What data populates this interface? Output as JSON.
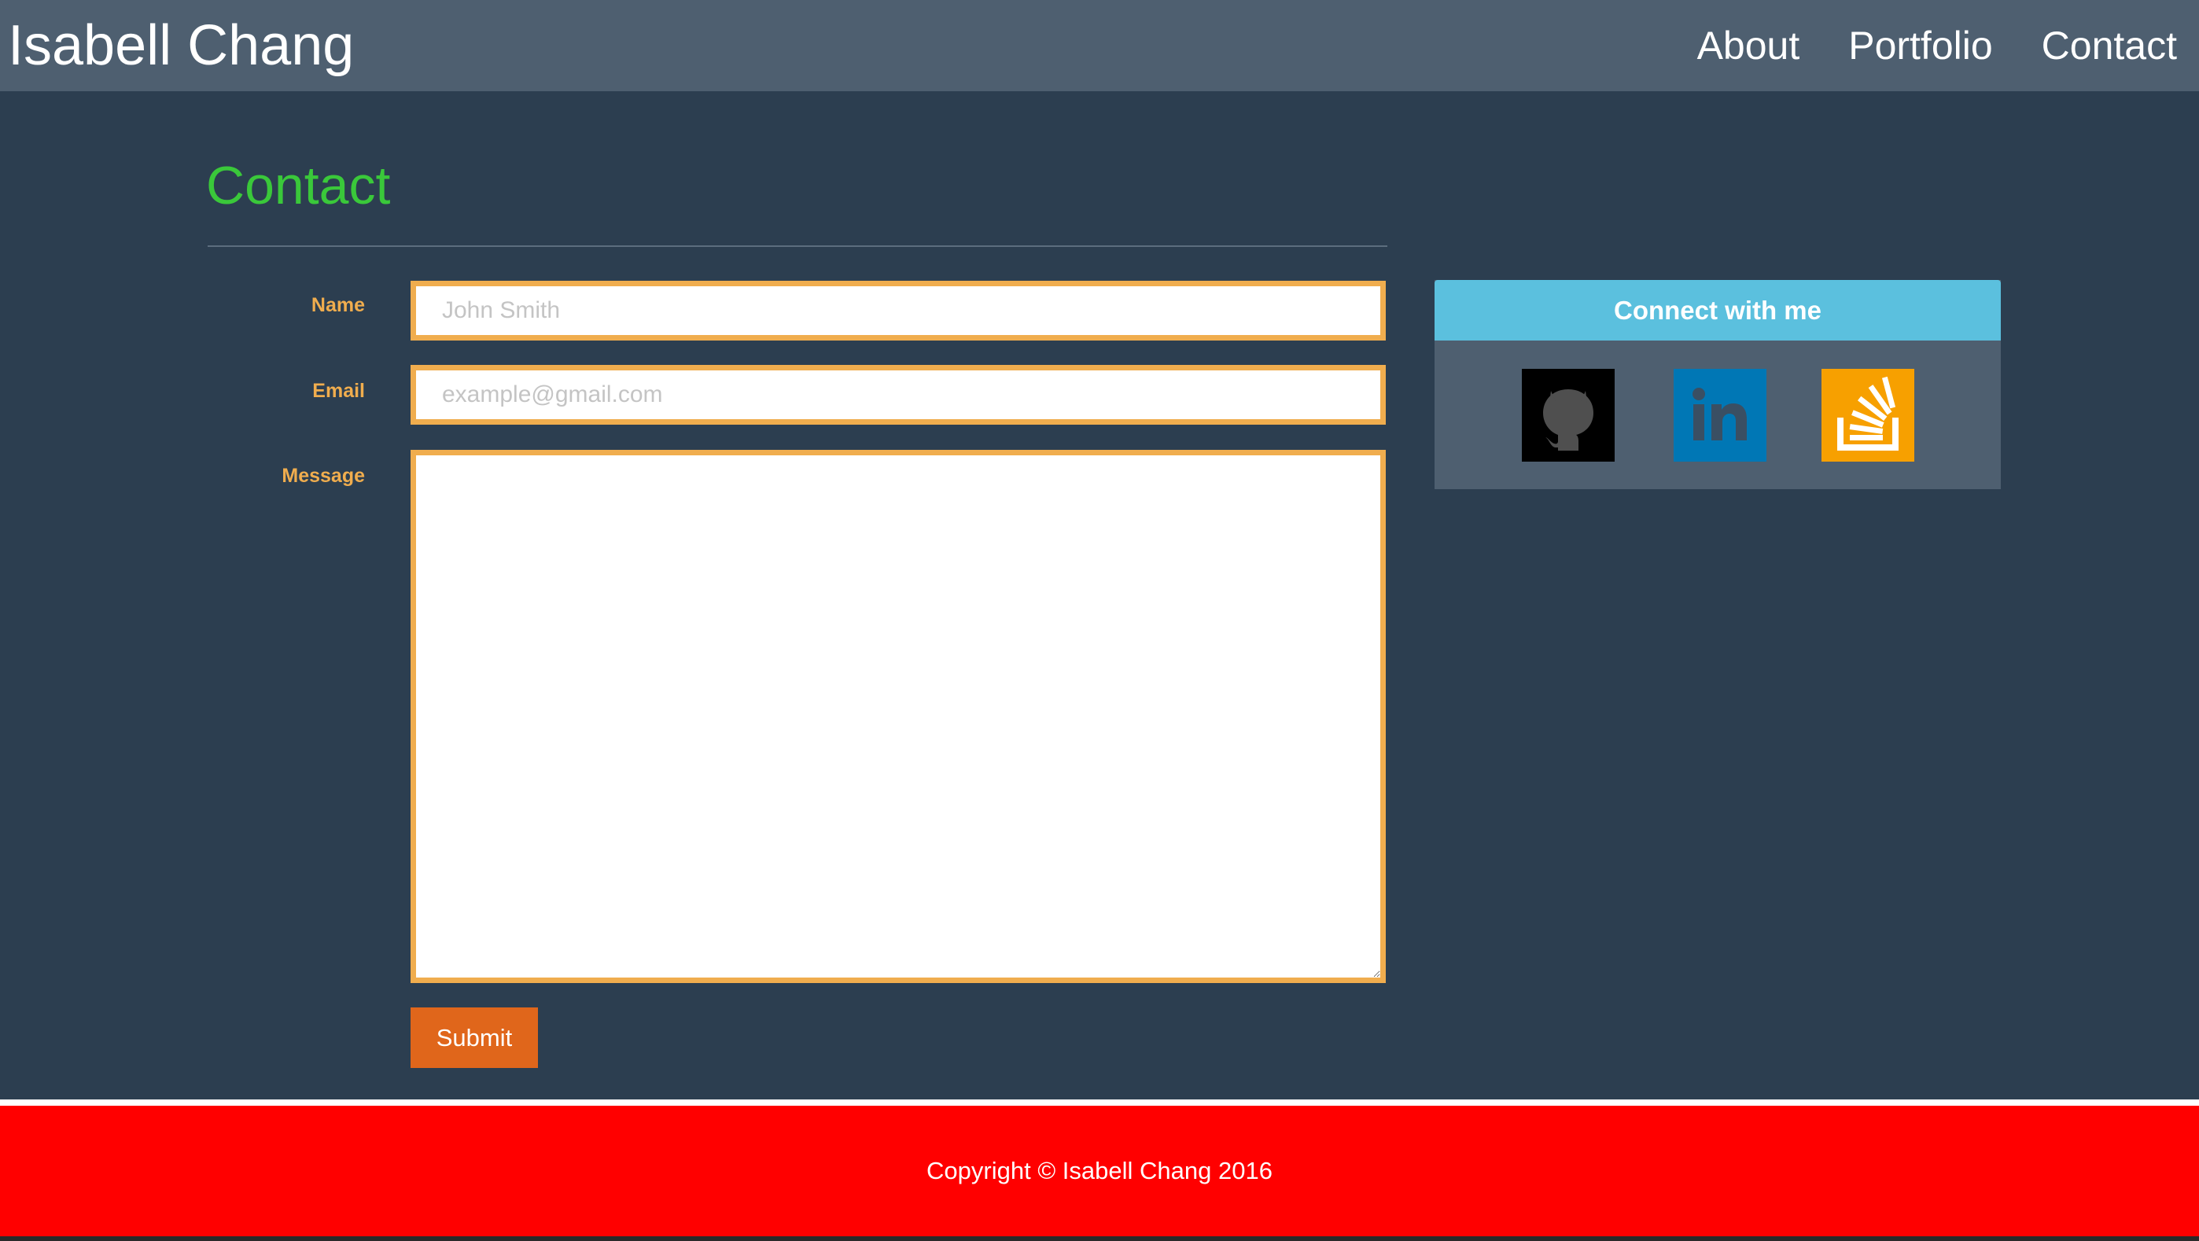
{
  "navbar": {
    "brand": "Isabell Chang",
    "links": [
      {
        "label": "About"
      },
      {
        "label": "Portfolio"
      },
      {
        "label": "Contact"
      }
    ]
  },
  "contact": {
    "title": "Contact",
    "form": {
      "name_label": "Name",
      "name_value": "",
      "name_placeholder": "John Smith",
      "email_label": "Email",
      "email_value": "",
      "email_placeholder": "example@gmail.com",
      "message_label": "Message",
      "message_value": "",
      "submit_label": "Submit"
    }
  },
  "connect": {
    "title": "Connect with me",
    "links": [
      {
        "icon": "github-icon"
      },
      {
        "icon": "linkedin-icon"
      },
      {
        "icon": "stackoverflow-icon"
      }
    ]
  },
  "footer": {
    "copyright": "Copyright © Isabell Chang 2016"
  },
  "colors": {
    "navbar_bg": "#4e5f70",
    "page_bg": "#2c3e50",
    "title_green": "#3ac83a",
    "label_orange": "#f0ad4e",
    "submit_orange": "#e0661b",
    "panel_header_blue": "#5bc0de",
    "footer_red": "#ff0000",
    "github_black": "#000000",
    "linkedin_blue": "#0077b5",
    "stackoverflow_orange": "#f7a000"
  }
}
